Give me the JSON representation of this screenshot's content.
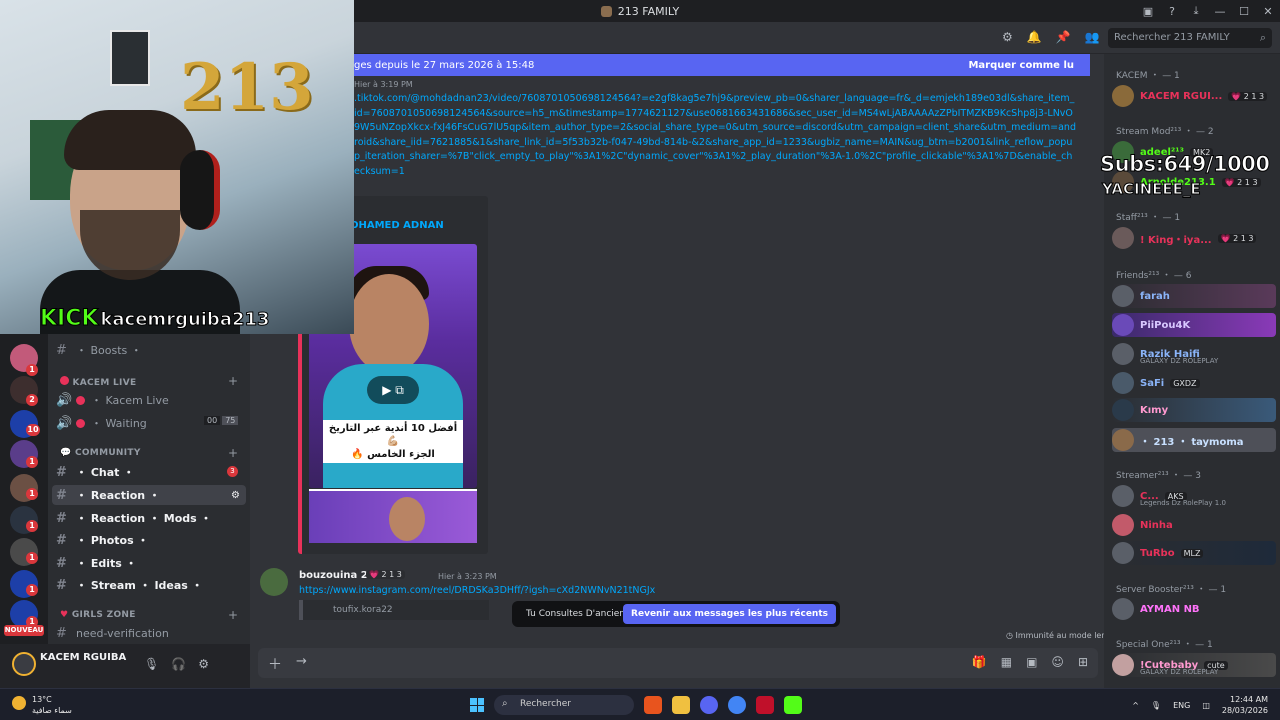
{
  "window": {
    "title": "213 FAMILY"
  },
  "header": {
    "search_placeholder": "Rechercher 213 FAMILY"
  },
  "new_messages": {
    "text": "ges depuis le 27 mars 2026 à 15:48",
    "mark_read": "Marquer comme lu"
  },
  "stream": {
    "platform": "KICK",
    "channel": "kacemrguiba213",
    "subs": "Subs:649/1000",
    "subs_user": "YACINEEE_E"
  },
  "message1": {
    "time": "Hier à 3:19 PM",
    "link": ".tiktok.com/@mohdadnan23/video/7608701050698124564?=e2gf8kag5e7hj9&preview_pb=0&sharer_language=fr&_d=emjekh189e03dl&share_item_id=7608701050698124564&source=h5_m&timestamp=1774621127&use0681663431686&sec_user_id=MS4wLjABAAAAzZPbITMZKB9KcShp8j3-LNvO9W5uNZopXkcx-fxJ46FsCuG7lU5qp&item_author_type=2&social_share_type=0&utm_source=discord&utm_campaign=client_share&utm_medium=android&share_iid=7621885&1&share_link_id=5f53b32b-f047-49bd-814b-&2&share_app_id=1233&ugbiz_name=MAIN&ug_btm=b2001&link_reflow_popup_iteration_sharer=%7B\"click_empty_to_play\"%3A1%2C\"dynamic_cover\"%3A1%2_play_duration\"%3A-1.0%2C\"profile_clickable\"%3A1%7D&enable_checksum=1",
    "embed_author": "OHAMED ADNAN",
    "video_caption_1": "أفضل 10 أندية عبر التاريخ 💪🏼",
    "video_caption_2": "الجزء الخامس 🔥"
  },
  "message2": {
    "author": "bouzouina 213",
    "tag": "💗 2 1 3",
    "time": "Hier à 3:23 PM",
    "url": "https://www.instagram.com/reel/DRDSKa3DHff/?igsh=cXd2NWNvN21tNGJx",
    "quote_author": "toufix.kora22"
  },
  "toast": {
    "text": "Tu Consultes D'anciens Messages",
    "button": "Revenir aux messages les plus récents"
  },
  "immunity": "Immunité au mode lent",
  "channels": {
    "boosts": "・ Boosts ・",
    "cat_kacem_live": "KACEM LIVE",
    "kacem_live": "・ Kacem Live",
    "waiting": "・ Waiting",
    "waiting_count_a": "00",
    "waiting_count_b": "75",
    "cat_community": "COMMUNITY",
    "chat": "・ Chat ・",
    "chat_badge": "3",
    "reaction": "・ Reaction ・",
    "reaction_mods": "・ Reaction ・ Mods ・",
    "photos": "・ Photos ・",
    "edits": "・ Edits ・",
    "stream_ideas": "・ Stream ・ Ideas ・",
    "cat_girls": "GIRLS ZONE",
    "need_verification": "need-verification"
  },
  "rail": {
    "nouveau": "NOUVEAU",
    "badges": [
      "1",
      "2",
      "10",
      "1",
      "1",
      "1",
      "1",
      "1",
      "1"
    ]
  },
  "user_panel": {
    "name": "KACEM RGUIBA"
  },
  "members": {
    "cat_kacem": "KACEM ・ — 1",
    "kacem_name": "KACEM RGUI...",
    "kacem_tag": "💗 2 1 3",
    "cat_streammod": "Stream Mod²¹³ ・ — 2",
    "m1_name": "adeel²¹³",
    "m1_tag": "MK2",
    "m2_name": "Arnolde213.1",
    "m2_tag": "💗 2 1 3",
    "cat_staff": "Staff²¹³ ・ — 1",
    "staff_name": "! King・iya...",
    "staff_tag": "💗 2 1 3",
    "cat_friends": "Friends²¹³ ・ — 6",
    "f1": "farah",
    "f2": "PiiPou4K",
    "f3": "Razik Haifi",
    "f3_sub": "GALAXY DZ ROLEPLAY",
    "f4": "SaFi",
    "f4_tag": "GXDZ",
    "f5": "Kımy",
    "f6": "・ 213 ・ taymoma",
    "cat_streamer": "Streamer²¹³ ・ — 3",
    "s1": "C...",
    "s1_tag": "AKS",
    "s1_sub": "Legends Dz RolePlay 1.0",
    "s2": "Ninha",
    "s3": "TuRbo",
    "s3_tag": "MLZ",
    "cat_booster": "Server Booster²¹³ ・ — 1",
    "b1": "AYMAN NB",
    "cat_special": "Special One²¹³ ・ — 1",
    "sp1": "!Cutebaby",
    "sp1_tag": "cute",
    "sp1_sub": "GALAXY DZ ROLEPLAY"
  },
  "taskbar": {
    "temp": "13°C",
    "weather": "سماء صافية",
    "search": "Rechercher",
    "lang": "ENG",
    "time": "12:44 AM",
    "date": "28/03/2026"
  },
  "colors": {
    "accent": "#5865f2",
    "link": "#00a8fc",
    "kick_green": "#53fc18",
    "embed_border": "#e8325a"
  }
}
